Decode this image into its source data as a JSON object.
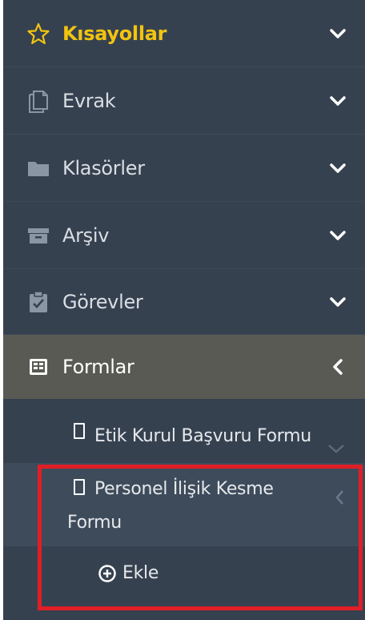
{
  "menu": {
    "items": [
      {
        "label": "Kısayollar",
        "icon": "star-icon",
        "expanded": true
      },
      {
        "label": "Evrak",
        "icon": "document-icon",
        "expanded": true
      },
      {
        "label": "Klasörler",
        "icon": "folder-icon",
        "expanded": true
      },
      {
        "label": "Arşiv",
        "icon": "archive-icon",
        "expanded": true
      },
      {
        "label": "Görevler",
        "icon": "task-icon",
        "expanded": true
      },
      {
        "label": "Formlar",
        "icon": "form-icon",
        "expanded": false,
        "active": true
      }
    ],
    "forms": {
      "items": [
        {
          "label": "Etik Kurul Başvuru Formu",
          "icon": "file-icon"
        },
        {
          "label_line1": "Personel İlişik Kesme",
          "label_line2": "Formu",
          "icon": "file-icon"
        }
      ],
      "add_label": "Ekle"
    }
  },
  "colors": {
    "sidebar_bg": "#364150",
    "active_bg": "#5a5a54",
    "favorite": "#f1c40f",
    "highlight": "#e01e26"
  }
}
